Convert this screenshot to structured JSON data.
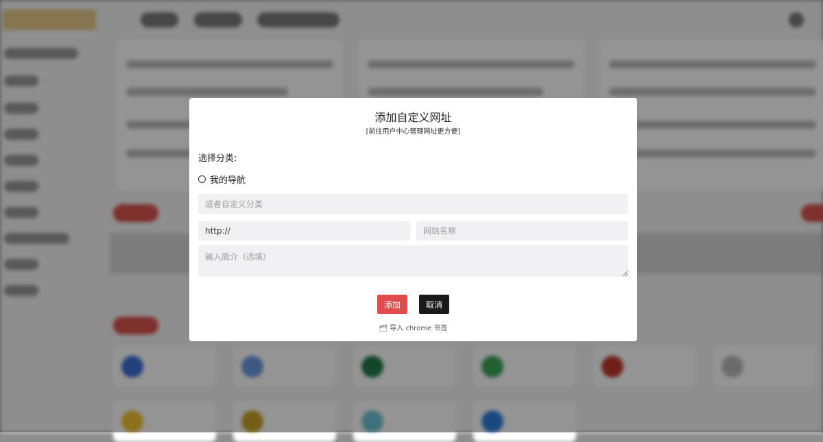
{
  "modal": {
    "title": "添加自定义网址",
    "subtitle": "[前往用户中心管理网址更方便]",
    "category_label": "选择分类:",
    "radio_option": "我的导航",
    "custom_category_placeholder": "或者自定义分类",
    "url_value": "http://",
    "site_name_placeholder": "网站名称",
    "description_placeholder": "输入简介（选填）",
    "add_button": "添加",
    "cancel_button": "取消",
    "import_link": "导入 chrome 书签",
    "import_icon": "import-icon"
  },
  "colors": {
    "add_button": "#e04c4c",
    "cancel_button": "#1a1a1a",
    "field_background": "#f1f1f4"
  }
}
